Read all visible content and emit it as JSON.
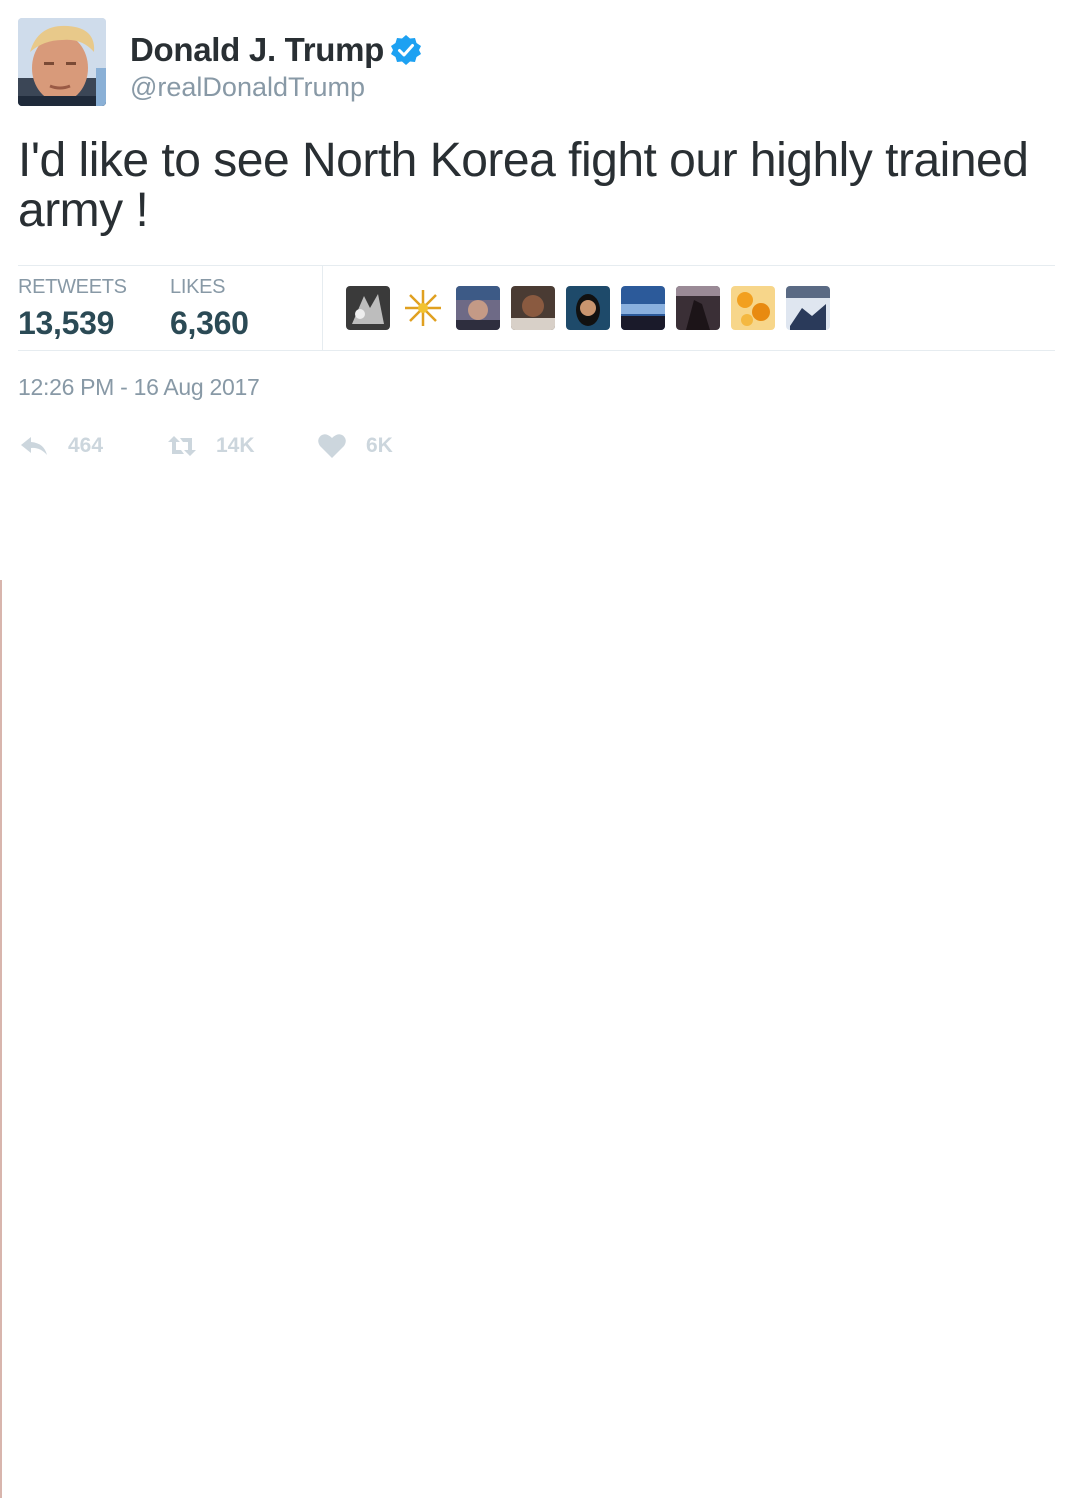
{
  "user": {
    "display_name": "Donald J. Trump",
    "handle": "@realDonaldTrump",
    "verified": true,
    "avatar_icon": "profile-photo"
  },
  "tweet": {
    "text": "I'd like to see North Korea fight our highly trained army !",
    "timestamp": "12:26 PM - 16 Aug 2017"
  },
  "stats": {
    "retweets_label": "RETWEETS",
    "retweets_value": "13,539",
    "likes_label": "LIKES",
    "likes_value": "6,360"
  },
  "likers": [
    {
      "icon": "liker-avatar-1"
    },
    {
      "icon": "liker-avatar-2"
    },
    {
      "icon": "liker-avatar-3"
    },
    {
      "icon": "liker-avatar-4"
    },
    {
      "icon": "liker-avatar-5"
    },
    {
      "icon": "liker-avatar-6"
    },
    {
      "icon": "liker-avatar-7"
    },
    {
      "icon": "liker-avatar-8"
    },
    {
      "icon": "liker-avatar-9"
    }
  ],
  "actions": {
    "reply_count": "464",
    "retweet_count": "14K",
    "like_count": "6K"
  },
  "colors": {
    "text": "#292f33",
    "muted": "#8899a6",
    "stat_value": "#2b4a55",
    "verified_blue": "#1da1f2",
    "action_gray": "#ccd6dd"
  }
}
